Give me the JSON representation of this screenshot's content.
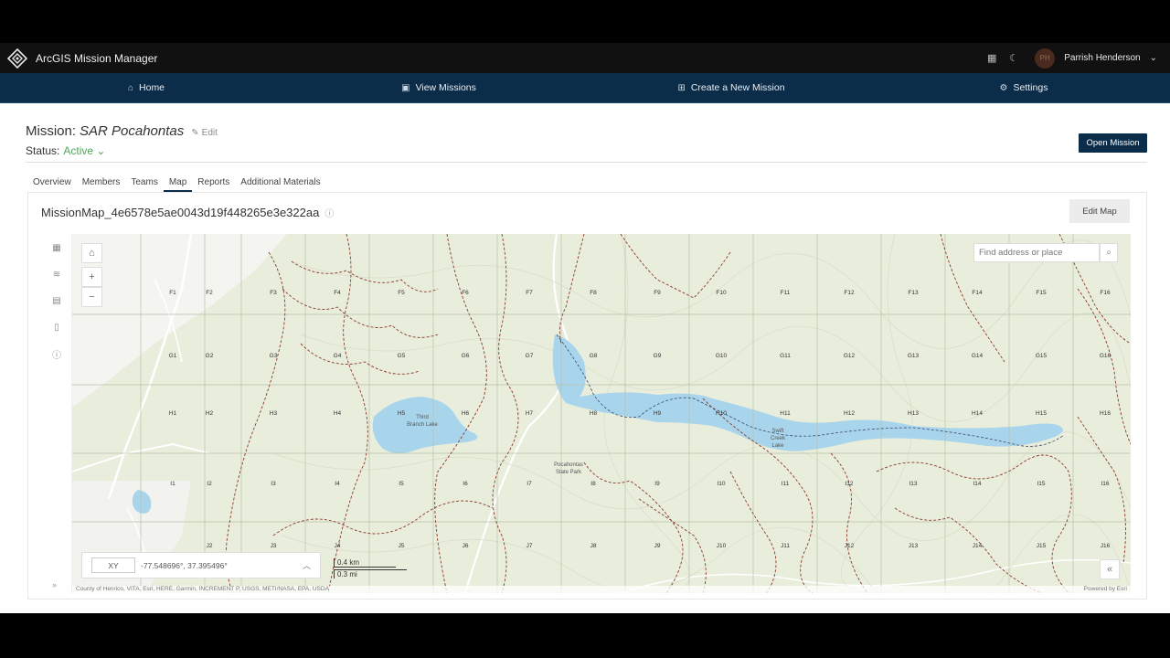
{
  "app": {
    "title": "ArcGIS Mission Manager",
    "user_name": "Parrish Henderson",
    "user_initials": "PH"
  },
  "nav": [
    {
      "label": "Home",
      "icon": "home-icon"
    },
    {
      "label": "View Missions",
      "icon": "image-icon"
    },
    {
      "label": "Create a New Mission",
      "icon": "plus-square-icon"
    },
    {
      "label": "Settings",
      "icon": "gear-icon"
    }
  ],
  "mission": {
    "prefix": "Mission:",
    "name": "SAR Pocahontas",
    "edit_label": "Edit",
    "status_label": "Status:",
    "status_value": "Active",
    "open_button": "Open Mission"
  },
  "tabs": [
    "Overview",
    "Members",
    "Teams",
    "Map",
    "Reports",
    "Additional Materials"
  ],
  "active_tab": "Map",
  "map": {
    "title": "MissionMap_4e6578e5ae0043d19f448265e3e322aa",
    "edit_button": "Edit Map",
    "search_placeholder": "Find address or place",
    "coord_system": "XY",
    "coordinates": "-77.548696°, 37.395496°",
    "scale_km": "0.4 km",
    "scale_mi": "0.3 mi",
    "attribution": "County of Henrico, VITA, Esri, HERE, Garmin, INCREMENT P, USGS, METI/NASA, EPA, USDA",
    "powered_by": "Powered by Esri",
    "places": [
      "Third Branch Lake",
      "Swift Creek Lake",
      "Pocahontas State Park"
    ],
    "grid_rows": [
      "F",
      "G",
      "H",
      "I",
      "J"
    ],
    "grid_cols_F": [
      "F1",
      "F2",
      "F3",
      "F4",
      "F5",
      "F6",
      "F7",
      "F8",
      "F9",
      "F10",
      "F11",
      "F12",
      "F13",
      "F14",
      "F15",
      "F16"
    ],
    "grid_cols_G": [
      "G1",
      "G2",
      "G3",
      "G4",
      "G5",
      "G6",
      "G7",
      "G8",
      "G9",
      "G10",
      "G11",
      "G12",
      "G13",
      "G14",
      "G15",
      "G16"
    ],
    "grid_cols_H": [
      "H1",
      "H2",
      "H3",
      "H4",
      "H5",
      "H6",
      "H7",
      "H8",
      "H9",
      "H10",
      "H11",
      "H12",
      "H13",
      "H14",
      "H15",
      "H16"
    ],
    "grid_cols_I": [
      "I1",
      "I2",
      "I3",
      "I4",
      "I5",
      "I6",
      "I7",
      "I8",
      "I9",
      "I10",
      "I11",
      "I12",
      "I13",
      "I14",
      "I15",
      "I16"
    ],
    "grid_cols_J": [
      "J2",
      "J3",
      "J4",
      "J5",
      "J6",
      "J7",
      "J8",
      "J9",
      "J10",
      "J11",
      "J12",
      "J13",
      "J14",
      "J15",
      "J16"
    ]
  },
  "colors": {
    "nav_bg": "#0b2d4a",
    "topbar_bg": "#111111",
    "status_active": "#56a35c",
    "water": "#a9d5ec",
    "map_bg": "#e9eddc",
    "trail": "#8b3a2a"
  }
}
